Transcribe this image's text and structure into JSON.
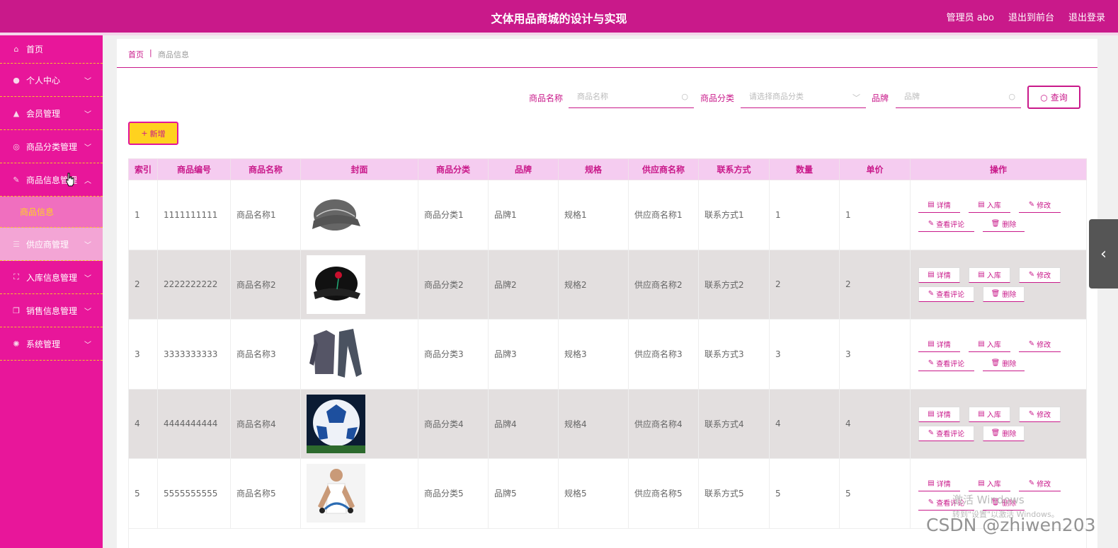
{
  "header": {
    "title": "文体用品商城的设计与实现",
    "admin": "管理员 abo",
    "front": "退出到前台",
    "logout": "退出登录"
  },
  "sidebar": {
    "items": [
      {
        "label": "首页",
        "icon": "home-icon"
      },
      {
        "label": "个人中心",
        "icon": "user-icon"
      },
      {
        "label": "会员管理",
        "icon": "thumbs-up-icon"
      },
      {
        "label": "商品分类管理",
        "icon": "compass-icon"
      },
      {
        "label": "商品信息管理",
        "icon": "brush-icon"
      },
      {
        "label": "商品信息",
        "icon": ""
      },
      {
        "label": "供应商管理",
        "icon": "list-icon"
      },
      {
        "label": "入库信息管理",
        "icon": "fullscreen-icon"
      },
      {
        "label": "销售信息管理",
        "icon": "copy-icon"
      },
      {
        "label": "系统管理",
        "icon": "settings-icon"
      }
    ]
  },
  "breadcrumb": {
    "home": "首页",
    "sep": "|",
    "current": "商品信息"
  },
  "search": {
    "name_label": "商品名称",
    "name_placeholder": "商品名称",
    "category_label": "商品分类",
    "category_placeholder": "请选择商品分类",
    "brand_label": "品牌",
    "brand_placeholder": "品牌",
    "query": "查询"
  },
  "add": "新增",
  "table": {
    "headers": [
      "索引",
      "商品编号",
      "商品名称",
      "封面",
      "商品分类",
      "品牌",
      "规格",
      "供应商名称",
      "联系方式",
      "数量",
      "单价",
      "操作"
    ],
    "rows": [
      {
        "index": "1",
        "code": "1111111111",
        "name": "商品名称1",
        "category": "商品分类1",
        "brand": "品牌1",
        "spec": "规格1",
        "supplier": "供应商名称1",
        "contact": "联系方式1",
        "qty": "1",
        "price": "1",
        "cover": "cap-image"
      },
      {
        "index": "2",
        "code": "2222222222",
        "name": "商品名称2",
        "category": "商品分类2",
        "brand": "品牌2",
        "spec": "规格2",
        "supplier": "供应商名称2",
        "contact": "联系方式2",
        "qty": "2",
        "price": "2",
        "cover": "cap-rose-image"
      },
      {
        "index": "3",
        "code": "3333333333",
        "name": "商品名称3",
        "category": "商品分类3",
        "brand": "品牌3",
        "spec": "规格3",
        "supplier": "供应商名称3",
        "contact": "联系方式3",
        "qty": "3",
        "price": "3",
        "cover": "tracksuit-image"
      },
      {
        "index": "4",
        "code": "4444444444",
        "name": "商品名称4",
        "category": "商品分类4",
        "brand": "品牌4",
        "spec": "规格4",
        "supplier": "供应商名称4",
        "contact": "联系方式4",
        "qty": "4",
        "price": "4",
        "cover": "soccer-ball-image"
      },
      {
        "index": "5",
        "code": "5555555555",
        "name": "商品名称5",
        "category": "商品分类5",
        "brand": "品牌5",
        "spec": "规格5",
        "supplier": "供应商名称5",
        "contact": "联系方式5",
        "qty": "5",
        "price": "5",
        "cover": "athlete-image"
      }
    ],
    "actions": {
      "detail": "详情",
      "stock": "入库",
      "edit": "修改",
      "comments": "查看评论",
      "delete": "删除"
    }
  },
  "watermark": {
    "line1": "激活 Windows",
    "line2": "转到\"设置\"以激活 Windows。",
    "csdn": "CSDN @zhiwen203"
  },
  "colors": {
    "primary": "#c9198a",
    "sidebar": "#e8169a",
    "accent": "#ffd21f",
    "header_row": "#f5ccf0"
  }
}
